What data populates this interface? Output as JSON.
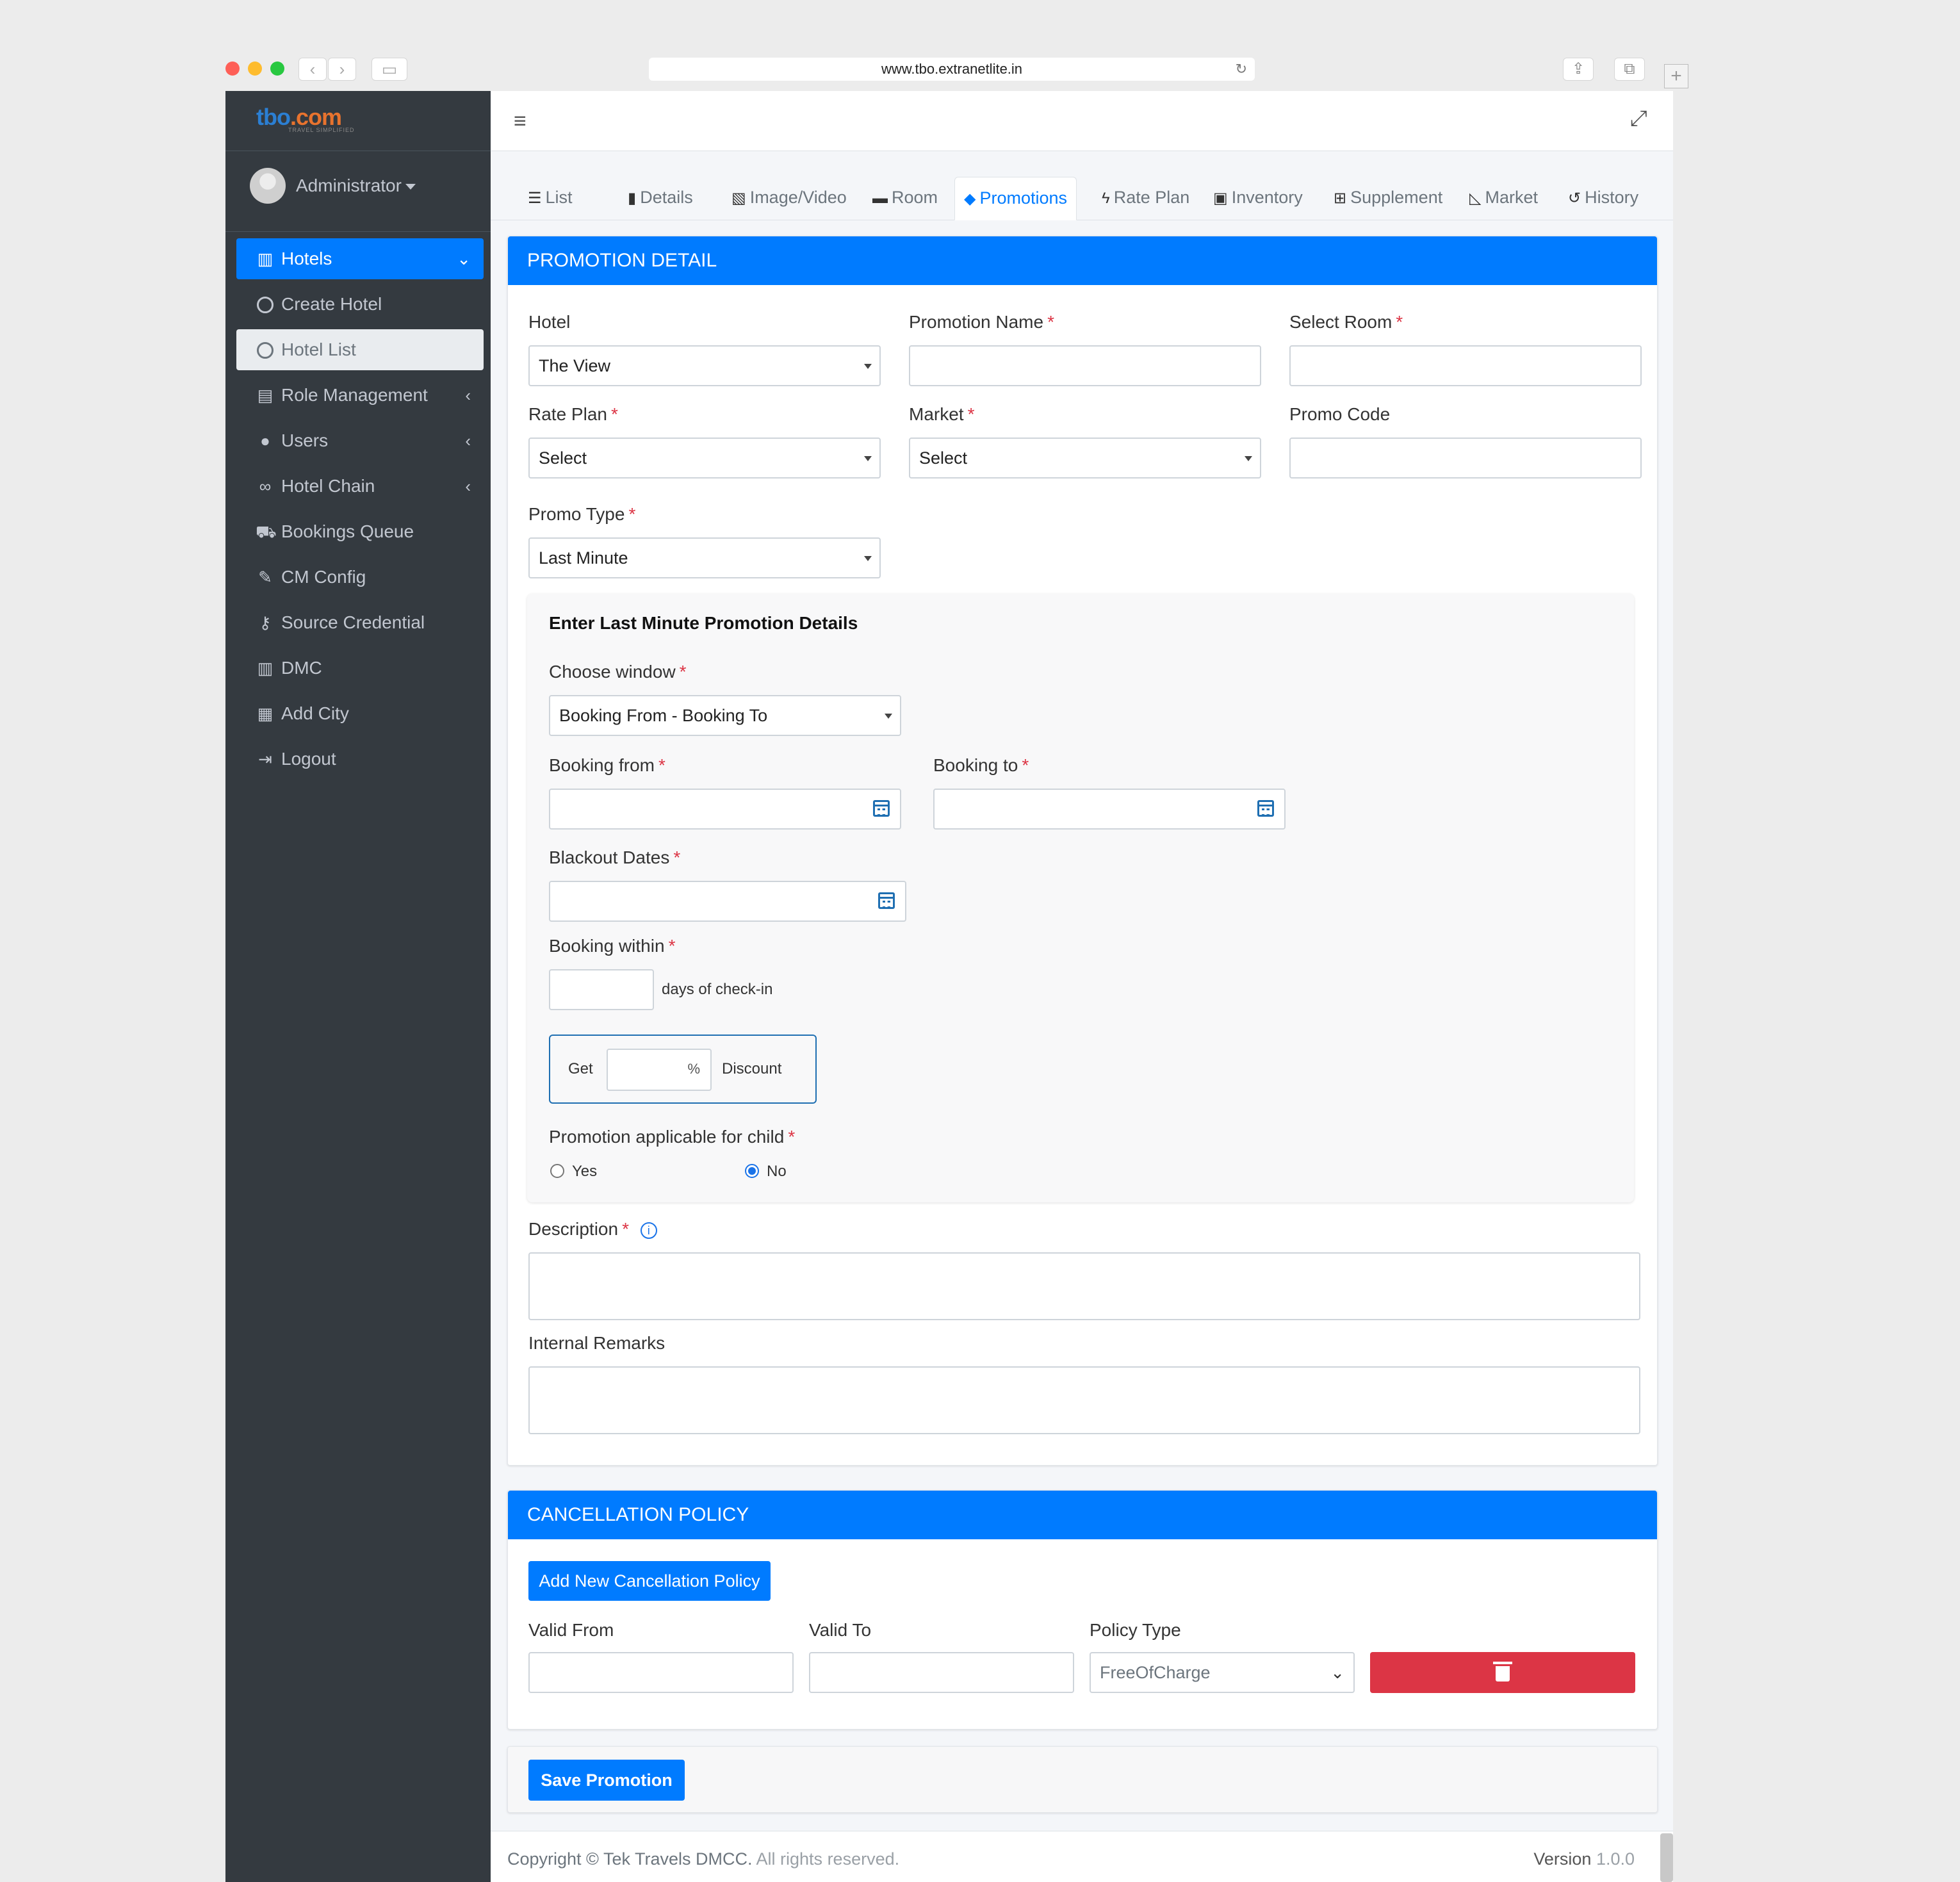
{
  "browser": {
    "url": "www.tbo.extranetlite.in"
  },
  "brand": {
    "logo_main": "tbo",
    "logo_suffix": ".com",
    "tagline": "TRAVEL SIMPLIFIED"
  },
  "user": {
    "name": "Administrator"
  },
  "sidebar": {
    "items": [
      {
        "label": "Hotels",
        "icon": "building-icon"
      },
      {
        "label": "Create Hotel",
        "icon": "circle-icon"
      },
      {
        "label": "Hotel List",
        "icon": "circle-icon"
      },
      {
        "label": "Role Management",
        "icon": "clipboard-icon"
      },
      {
        "label": "Users",
        "icon": "user-icon"
      },
      {
        "label": "Hotel Chain",
        "icon": "link-icon"
      },
      {
        "label": "Bookings Queue",
        "icon": "cart-icon"
      },
      {
        "label": "CM Config",
        "icon": "wrench-icon"
      },
      {
        "label": "Source Credential",
        "icon": "key-icon"
      },
      {
        "label": "DMC",
        "icon": "building-icon"
      },
      {
        "label": "Add City",
        "icon": "city-icon"
      },
      {
        "label": "Logout",
        "icon": "logout-icon"
      }
    ]
  },
  "tabs": [
    {
      "label": "List"
    },
    {
      "label": "Details"
    },
    {
      "label": "Image/Video"
    },
    {
      "label": "Room"
    },
    {
      "label": "Promotions"
    },
    {
      "label": "Rate Plan"
    },
    {
      "label": "Inventory"
    },
    {
      "label": "Supplement"
    },
    {
      "label": "Market"
    },
    {
      "label": "History"
    }
  ],
  "promotion": {
    "header": "PROMOTION DETAIL",
    "hotel_label": "Hotel",
    "hotel_value": "The View",
    "promo_name_label": "Promotion Name",
    "promo_name_value": "",
    "select_room_label": "Select Room",
    "select_room_value": "",
    "rate_plan_label": "Rate Plan",
    "rate_plan_value": "Select",
    "market_label": "Market",
    "market_value": "Select",
    "promo_code_label": "Promo Code",
    "promo_code_value": "",
    "promo_type_label": "Promo Type",
    "promo_type_value": "Last Minute",
    "required_mark": "*",
    "last_minute": {
      "title": "Enter Last Minute Promotion Details",
      "window_label": "Choose window",
      "window_value": "Booking From - Booking To",
      "booking_from_label": "Booking from",
      "booking_to_label": "Booking to",
      "blackout_label": "Blackout Dates",
      "booking_within_label": "Booking within",
      "days_suffix": "days of check-in",
      "get_label": "Get",
      "percent": "%",
      "discount_label": "Discount",
      "child_label": "Promotion applicable for child",
      "child_options": [
        "Yes",
        "No"
      ],
      "child_selected": "No"
    },
    "description_label": "Description",
    "internal_remarks_label": "Internal Remarks"
  },
  "cancellation": {
    "header": "CANCELLATION POLICY",
    "add_button": "Add New Cancellation Policy",
    "valid_from_label": "Valid From",
    "valid_to_label": "Valid To",
    "policy_type_label": "Policy Type",
    "policy_type_value": "FreeOfCharge"
  },
  "save_button": "Save Promotion",
  "footer": {
    "copyright": "Copyright ©",
    "company": "Tek Travels DMCC.",
    "rights": "All rights reserved.",
    "version_label": "Version",
    "version": "1.0.0"
  },
  "colors": {
    "primary": "#007bff",
    "danger": "#dc3545",
    "sidebar": "#343a40"
  }
}
